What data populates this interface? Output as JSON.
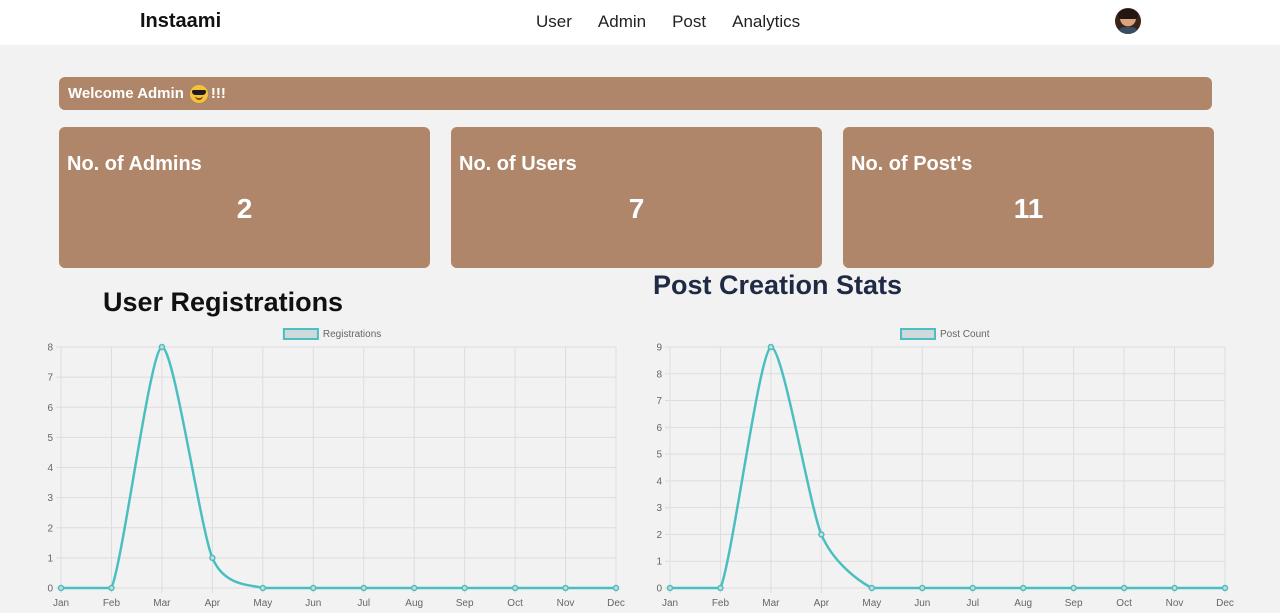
{
  "navbar": {
    "brand": "Instaami",
    "links": [
      "User",
      "Admin",
      "Post",
      "Analytics"
    ]
  },
  "welcome": {
    "prefix": "Welcome Admin",
    "emoji": "smiling-face-with-sunglasses",
    "suffix": "!!!"
  },
  "cards": [
    {
      "title": "No. of Admins",
      "value": "2"
    },
    {
      "title": "No. of Users",
      "value": "7"
    },
    {
      "title": "No. of Post's",
      "value": "11"
    }
  ],
  "colors": {
    "accent": "#b0866a",
    "line": "#4bbfc0",
    "legend_fill": "#cfd9dc",
    "grid": "#dddddd"
  },
  "chart_data": [
    {
      "type": "line",
      "title": "User Registrations",
      "categories": [
        "Jan",
        "Feb",
        "Mar",
        "Apr",
        "May",
        "Jun",
        "Jul",
        "Aug",
        "Sep",
        "Oct",
        "Nov",
        "Dec"
      ],
      "series": [
        {
          "name": "Registrations",
          "values": [
            0,
            0,
            8,
            1,
            0,
            0,
            0,
            0,
            0,
            0,
            0,
            0
          ]
        }
      ],
      "ylim": [
        0,
        8
      ],
      "yticks": [
        0,
        1,
        2,
        3,
        4,
        5,
        6,
        7,
        8
      ],
      "grid": true,
      "legend": "top-center"
    },
    {
      "type": "line",
      "title": "Post Creation Stats",
      "categories": [
        "Jan",
        "Feb",
        "Mar",
        "Apr",
        "May",
        "Jun",
        "Jul",
        "Aug",
        "Sep",
        "Oct",
        "Nov",
        "Dec"
      ],
      "series": [
        {
          "name": "Post Count",
          "values": [
            0,
            0,
            9,
            2,
            0,
            0,
            0,
            0,
            0,
            0,
            0,
            0
          ]
        }
      ],
      "ylim": [
        0,
        9
      ],
      "yticks": [
        0,
        1,
        2,
        3,
        4,
        5,
        6,
        7,
        8,
        9
      ],
      "grid": true,
      "legend": "top-center"
    }
  ]
}
